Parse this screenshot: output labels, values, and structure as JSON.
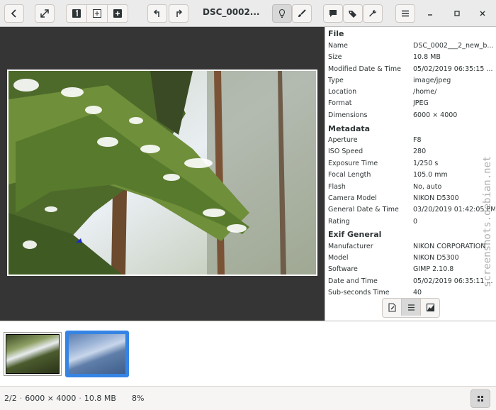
{
  "window": {
    "title": "DSC_0002..."
  },
  "file_section": {
    "heading": "File",
    "rows": [
      {
        "key": "Name",
        "value": "DSC_0002___2_new_b..."
      },
      {
        "key": "Size",
        "value": "10.8 MB"
      },
      {
        "key": "Modified Date & Time",
        "value": "05/02/2019 06:35:15 ..."
      },
      {
        "key": "Type",
        "value": "image/jpeg"
      },
      {
        "key": "Location",
        "value": "/home/"
      },
      {
        "key": "Format",
        "value": "JPEG"
      },
      {
        "key": "Dimensions",
        "value": "6000 × 4000"
      }
    ]
  },
  "metadata_section": {
    "heading": "Metadata",
    "rows": [
      {
        "key": "Aperture",
        "value": "F8"
      },
      {
        "key": "ISO Speed",
        "value": "280"
      },
      {
        "key": "Exposure Time",
        "value": "1/250 s"
      },
      {
        "key": "Focal Length",
        "value": "105.0 mm"
      },
      {
        "key": "Flash",
        "value": "No, auto"
      },
      {
        "key": "Camera Model",
        "value": "NIKON D5300"
      },
      {
        "key": "General Date & Time",
        "value": "03/20/2019 01:42:05 PM"
      },
      {
        "key": "Rating",
        "value": "0"
      }
    ]
  },
  "exif_section": {
    "heading": "Exif General",
    "rows": [
      {
        "key": "Manufacturer",
        "value": "NIKON CORPORATION"
      },
      {
        "key": "Model",
        "value": "NIKON D5300"
      },
      {
        "key": "Software",
        "value": "GIMP 2.10.8"
      },
      {
        "key": "Date and Time",
        "value": "05/02/2019 06:35:11 ..."
      },
      {
        "key": "Sub-seconds Time",
        "value": "40"
      }
    ]
  },
  "status": {
    "position": "2/2",
    "dimensions": "6000 × 4000",
    "size": "10.8 MB",
    "zoom": "8%"
  },
  "watermark": "screenshots.debian.net",
  "colors": {
    "accent": "#3584e4",
    "viewer_bg": "#353535"
  }
}
